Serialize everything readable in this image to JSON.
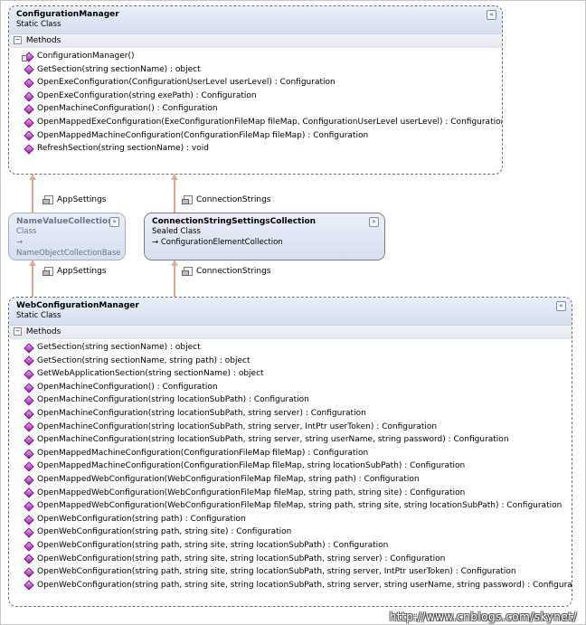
{
  "config_manager": {
    "name": "ConfigurationManager",
    "kind": "Static Class",
    "section": "Methods",
    "methods": [
      "ConfigurationManager()",
      "GetSection(string sectionName) : object",
      "OpenExeConfiguration(ConfigurationUserLevel userLevel) : Configuration",
      "OpenExeConfiguration(string exePath) : Configuration",
      "OpenMachineConfiguration() : Configuration",
      "OpenMappedExeConfiguration(ExeConfigurationFileMap fileMap, ConfigurationUserLevel userLevel) : Configuration",
      "OpenMappedMachineConfiguration(ConfigurationFileMap fileMap) : Configuration",
      "RefreshSection(string sectionName) : void"
    ]
  },
  "name_value_collection": {
    "name": "NameValueCollection",
    "kind": "Class",
    "base": "NameObjectCollectionBase"
  },
  "connection_strings_collection": {
    "name": "ConnectionStringSettingsCollection",
    "kind": "Sealed Class",
    "base": "ConfigurationElementCollection"
  },
  "web_config_manager": {
    "name": "WebConfigurationManager",
    "kind": "Static Class",
    "section": "Methods",
    "methods": [
      "GetSection(string sectionName) : object",
      "GetSection(string sectionName, string path) : object",
      "GetWebApplicationSection(string sectionName) : object",
      "OpenMachineConfiguration() : Configuration",
      "OpenMachineConfiguration(string locationSubPath) : Configuration",
      "OpenMachineConfiguration(string locationSubPath, string server) : Configuration",
      "OpenMachineConfiguration(string locationSubPath, string server, IntPtr userToken) : Configuration",
      "OpenMachineConfiguration(string locationSubPath, string server, string userName, string password) : Configuration",
      "OpenMappedMachineConfiguration(ConfigurationFileMap fileMap) : Configuration",
      "OpenMappedMachineConfiguration(ConfigurationFileMap fileMap, string locationSubPath) : Configuration",
      "OpenMappedWebConfiguration(WebConfigurationFileMap fileMap, string path) : Configuration",
      "OpenMappedWebConfiguration(WebConfigurationFileMap fileMap, string path, string site) : Configuration",
      "OpenMappedWebConfiguration(WebConfigurationFileMap fileMap, string path, string site, string locationSubPath) : Configuration",
      "OpenWebConfiguration(string path) : Configuration",
      "OpenWebConfiguration(string path, string site) : Configuration",
      "OpenWebConfiguration(string path, string site, string locationSubPath) : Configuration",
      "OpenWebConfiguration(string path, string site, string locationSubPath, string server) : Configuration",
      "OpenWebConfiguration(string path, string site, string locationSubPath, string server, IntPtr userToken) : Configuration",
      "OpenWebConfiguration(string path, string site, string locationSubPath, string server, string userName, string password) : Configuration"
    ]
  },
  "associations": {
    "top_appsettings": "AppSettings",
    "top_connectionstrings": "ConnectionStrings",
    "bottom_appsettings": "AppSettings",
    "bottom_connectionstrings": "ConnectionStrings"
  },
  "collapse_up_glyph": "«",
  "collapse_down_glyph": "»",
  "toggle_glyph": "−",
  "inherit_glyph": "→",
  "watermark": "http://www.cnblogs.com/skynet/",
  "colors": {
    "header_gradient_top": "#e9eef8",
    "header_gradient_bottom": "#d6dff0",
    "connector": "#e0a98d",
    "method_icon": "#a31bb3"
  }
}
